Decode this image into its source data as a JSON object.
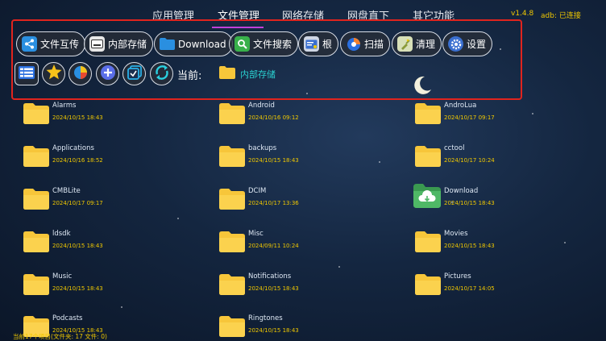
{
  "top_tabs": [
    "应用管理",
    "文件管理",
    "网络存储",
    "网盘直下",
    "其它功能"
  ],
  "active_tab": "文件管理",
  "version": "v1.4.8",
  "adb_status": "adb: 已连接",
  "toolbar_buttons": [
    {
      "label": "文件互传",
      "icon": "share-icon",
      "color": "#2a8fe0"
    },
    {
      "label": "内部存储",
      "icon": "storage-icon",
      "color": "#e8e8e8"
    },
    {
      "label": "Download",
      "icon": "folder-icon",
      "color": "#2a8fe0"
    },
    {
      "label": "文件搜索",
      "icon": "search-icon",
      "color": "#38b04a"
    },
    {
      "label": "根",
      "icon": "root-icon",
      "color": "#3a6fd0"
    },
    {
      "label": "扫描",
      "icon": "scan-icon",
      "color": "#2a6fe0"
    },
    {
      "label": "清理",
      "icon": "clean-icon",
      "color": "#8a9a3a"
    },
    {
      "label": "设置",
      "icon": "gear-icon",
      "color": "#3a6fd0"
    }
  ],
  "circle_buttons": [
    "list-view-icon",
    "star-icon",
    "pie-chart-icon",
    "add-icon",
    "multi-select-icon",
    "refresh-icon"
  ],
  "current_label": "当前:",
  "current_path": "内部存储",
  "files": [
    {
      "name": "Alarms",
      "date": "2024/10/15 18:43"
    },
    {
      "name": "Android",
      "date": "2024/10/16 09:12"
    },
    {
      "name": "AndroLua",
      "date": "2024/10/17 09:17"
    },
    {
      "name": "Applications",
      "date": "2024/10/16 18:52"
    },
    {
      "name": "backups",
      "date": "2024/10/15 18:43"
    },
    {
      "name": "cctool",
      "date": "2024/10/17 10:24"
    },
    {
      "name": "CMBLite",
      "date": "2024/10/17 09:17"
    },
    {
      "name": "DCIM",
      "date": "2024/10/17 13:36"
    },
    {
      "name": "Download",
      "date": "2024/10/15 18:43",
      "special": true
    },
    {
      "name": "ldsdk",
      "date": "2024/10/15 18:43"
    },
    {
      "name": "Misc",
      "date": "2024/09/11 10:24"
    },
    {
      "name": "Movies",
      "date": "2024/10/15 18:43"
    },
    {
      "name": "Music",
      "date": "2024/10/15 18:43"
    },
    {
      "name": "Notifications",
      "date": "2024/10/15 18:43"
    },
    {
      "name": "Pictures",
      "date": "2024/10/17 14:05"
    },
    {
      "name": "Podcasts",
      "date": "2024/10/15 18:43"
    },
    {
      "name": "Ringtones",
      "date": "2024/10/15 18:43"
    }
  ],
  "status": "当前17个项目(文件夹: 17  文件: 0)",
  "colors": {
    "accent_tab": "#c040d8",
    "highlight_frame": "#e0241e",
    "date_text": "#f0c800",
    "path_text": "#2ad0d0",
    "folder": "#f7c63a"
  }
}
